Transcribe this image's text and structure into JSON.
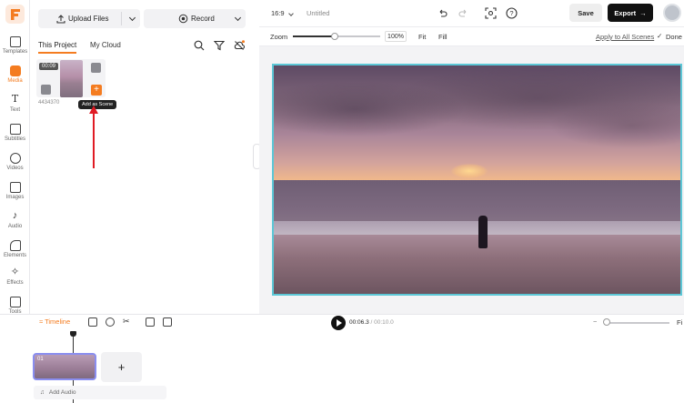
{
  "brand": {
    "accent": "#f47c20",
    "export_bg": "#111111",
    "selection_border": "#5cc7d6"
  },
  "sidebar": {
    "items": [
      {
        "label": "Templates",
        "icon": "templates-icon"
      },
      {
        "label": "Media",
        "icon": "media-icon",
        "active": true
      },
      {
        "label": "Text",
        "icon": "text-icon"
      },
      {
        "label": "Subtitles",
        "icon": "subtitles-icon"
      },
      {
        "label": "Videos",
        "icon": "videos-icon"
      },
      {
        "label": "Images",
        "icon": "images-icon"
      },
      {
        "label": "Audio",
        "icon": "audio-icon"
      },
      {
        "label": "Elements",
        "icon": "elements-icon"
      },
      {
        "label": "Effects",
        "icon": "effects-icon"
      },
      {
        "label": "Tools",
        "icon": "tools-icon"
      }
    ]
  },
  "media_panel": {
    "upload_label": "Upload Files",
    "record_label": "Record",
    "tabs": [
      "This Project",
      "My Cloud"
    ],
    "media_item": {
      "duration": "00:09",
      "file_id": "4434370"
    },
    "tooltip": "Add as Scene"
  },
  "topbar": {
    "aspect_ratio": "16:9",
    "project_title": "Untitled",
    "save_label": "Save",
    "export_label": "Export"
  },
  "zoombar": {
    "zoom_label": "Zoom",
    "zoom_value": "100%",
    "fit_label": "Fit",
    "fill_label": "Fill",
    "apply_all_label": "Apply to All Scenes",
    "done_label": "Done"
  },
  "timeline": {
    "label": "Timeline",
    "current_time": "00:06.3",
    "total_time": "/ 00:10.0",
    "fit_label": "Fi",
    "scene_number": "01",
    "add_scene": "+",
    "add_audio_label": "Add Audio"
  }
}
